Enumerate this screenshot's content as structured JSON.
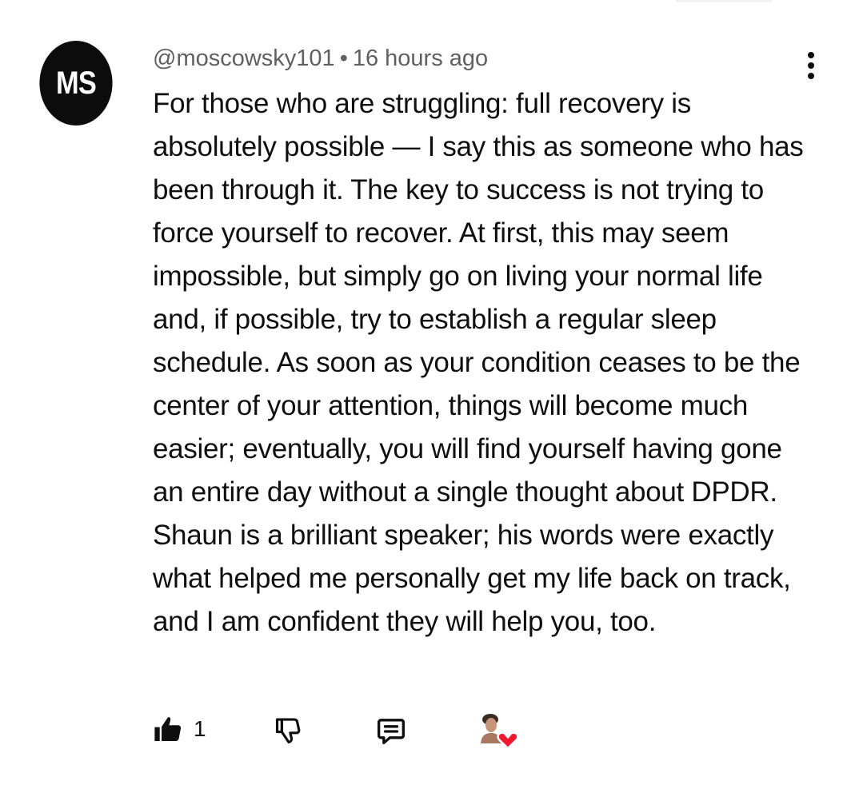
{
  "comment": {
    "avatar_initials": "MS",
    "author": "@moscowsky101",
    "separator": "•",
    "timestamp": "16 hours ago",
    "text": "For those who are struggling: full recovery is absolutely possible — I say this as someone who has been through it. The key to success is not trying to force yourself to recover. At first, this may seem impossible, but simply go on living your normal life and, if possible, try to establish a regular sleep schedule. As soon as your condition ceases to be the center of your attention, things will become much easier; eventually, you will find yourself having gone an entire day without a single thought about DPDR. Shaun is a brilliant speaker; his words were exactly what helped me personally get my life back on track, and I am confident they will help you, too."
  },
  "actions": {
    "like_count": "1",
    "like_icon": "thumbs-up-filled-icon",
    "dislike_icon": "thumbs-down-outline-icon",
    "reply_icon": "comment-reply-icon",
    "creator_heart_icon": "creator-heart-icon",
    "more_icon": "vertical-ellipsis-icon"
  },
  "colors": {
    "avatar_bg": "#0c0c0c",
    "text": "#0f0f0f",
    "meta": "#606060",
    "heart": "#f2182f"
  }
}
